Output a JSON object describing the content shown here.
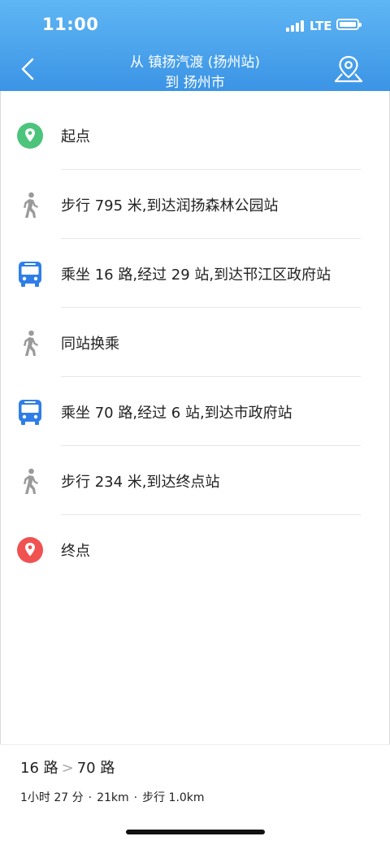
{
  "status_bar": {
    "time": "11:00",
    "network": "LTE"
  },
  "header": {
    "title_line1": "从 镇扬汽渡 (扬州站)",
    "title_line2": "到 扬州市",
    "colors": {
      "gradient_top": "#5fb6f4",
      "gradient_bottom": "#3b94e5"
    }
  },
  "steps": [
    {
      "icon": "start-pin-icon",
      "text": "起点",
      "color": "#4cc47c"
    },
    {
      "icon": "walk-icon",
      "text": "步行 795 米,到达润扬森林公园站",
      "color": "#9a9a9a"
    },
    {
      "icon": "bus-icon",
      "text": "乘坐 16 路,经过 29 站,到达邗江区政府站",
      "color": "#2f7ee8"
    },
    {
      "icon": "walk-icon",
      "text": "同站换乘",
      "color": "#9a9a9a"
    },
    {
      "icon": "bus-icon",
      "text": "乘坐 70 路,经过 6 站,到达市政府站",
      "color": "#2f7ee8"
    },
    {
      "icon": "walk-icon",
      "text": "步行 234 米,到达终点站",
      "color": "#9a9a9a"
    },
    {
      "icon": "end-pin-icon",
      "text": "终点",
      "color": "#f05252"
    }
  ],
  "summary": {
    "route_from": "16 路",
    "route_sep": ">",
    "route_to": "70 路",
    "duration": "1小时 27 分",
    "distance": "21km",
    "walk": "步行 1.0km",
    "dot": "·"
  }
}
